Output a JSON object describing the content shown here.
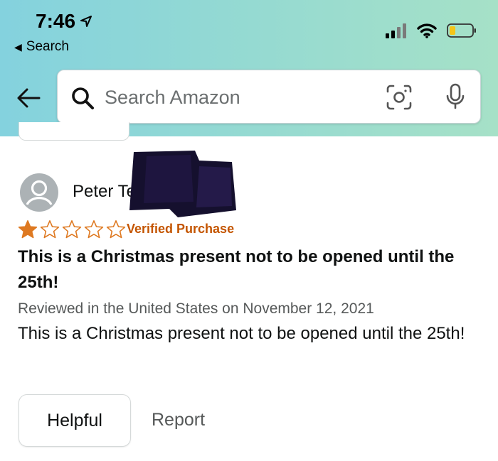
{
  "status_bar": {
    "time": "7:46",
    "back_app_label": "Search"
  },
  "search": {
    "placeholder": "Search Amazon"
  },
  "review": {
    "reviewer_name": "Peter Te",
    "rating": 1,
    "rating_max": 5,
    "verified_label": "Verified Purchase",
    "title": "This is a Christmas present not to be opened until the 25th!",
    "date_line": "Reviewed in the United States on November 12, 2021",
    "body": "This is a Christmas present not to be opened until the 25th!"
  },
  "actions": {
    "helpful_label": "Helpful",
    "report_label": "Report"
  },
  "colors": {
    "star": "#de7921",
    "verified": "#c45500",
    "header_gradient_start": "#84d2de",
    "header_gradient_end": "#a6e1c7"
  },
  "icons": [
    "location-arrow-icon",
    "back-triangle-icon",
    "signal-icon",
    "wifi-icon",
    "battery-icon",
    "back-arrow-icon",
    "search-icon",
    "camera-scan-icon",
    "mic-icon",
    "user-avatar-icon",
    "star-icon"
  ]
}
